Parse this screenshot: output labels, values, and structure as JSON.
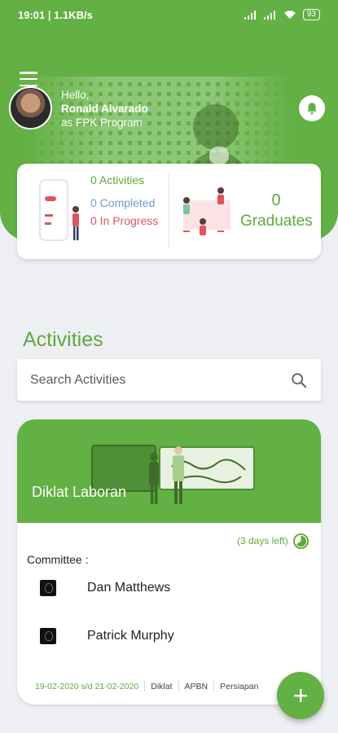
{
  "status_bar": {
    "left": "19:01 | 1.1KB/s",
    "battery": "93"
  },
  "header": {
    "greeting_hello": "Hello,",
    "greeting_name": "Ronald Alvarado",
    "greeting_role": "as FPK Program"
  },
  "stats": {
    "activities": "0 Activities",
    "completed": "0 Completed",
    "in_progress": "0 In Progress",
    "graduates_count": "0",
    "graduates_label": "Graduates"
  },
  "section": {
    "title": "Activities"
  },
  "search": {
    "placeholder": "Search Activities"
  },
  "activity": {
    "title": "Diklat Laboran",
    "days_left": "(3 days left)",
    "committee_label": "Committee :",
    "members": [
      "Dan Matthews",
      "Patrick Murphy"
    ],
    "date_range": "19-02-2020 s/d 21-02-2020",
    "tags": [
      "Diklat",
      "APBN",
      "Persiapan"
    ]
  },
  "colors": {
    "brand_green": "#63b044",
    "text_green": "#5fa93c",
    "completed_blue": "#6e9ed3",
    "progress_red": "#e0545f"
  },
  "icons": [
    "menu-icon",
    "bell-icon",
    "search-icon",
    "clock-icon",
    "plus-icon"
  ]
}
